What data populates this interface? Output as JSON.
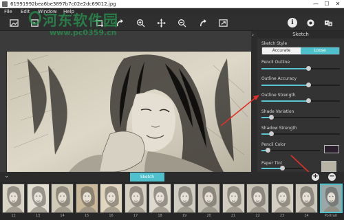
{
  "window": {
    "title": "61991992bea6be3897b7c02e2dc69012.jpg",
    "minimize": "—",
    "maximize": "☐",
    "close": "✕"
  },
  "menu": {
    "items": [
      "File",
      "Edit",
      "Window",
      "Help"
    ]
  },
  "watermark": {
    "text": "河东软件园",
    "url": "www.pc0359.cn"
  },
  "toolbar": {
    "icons": [
      "image-open-icon",
      "image-save-icon",
      "crop-icon",
      "undo-icon",
      "zoom-in-icon",
      "move-icon",
      "zoom-out-icon",
      "redo-icon",
      "fit-icon",
      "info-icon",
      "settings-icon",
      "effects-icon"
    ],
    "info_glyph": "i"
  },
  "panel": {
    "header": "Sketch",
    "sketch_style": {
      "label": "Sketch Style",
      "options": [
        "Accurate",
        "Loose"
      ],
      "selected": "Loose"
    },
    "sliders": [
      {
        "label": "Pencil Outline",
        "value": 0.6
      },
      {
        "label": "Outline Accuracy",
        "value": 0.6
      },
      {
        "label": "Outline Strength",
        "value": 0.6
      },
      {
        "label": "Shade Variation",
        "value": 0.12
      },
      {
        "label": "Shadow Strength",
        "value": 0.12
      }
    ],
    "pencil_color": {
      "label": "Pencil Color",
      "value": 0.1,
      "color": "#2a1f2a"
    },
    "paper_tint": {
      "label": "Paper Tint",
      "value": 0.5,
      "color": "#b8b3a5"
    }
  },
  "bottom": {
    "tab": "Sketch",
    "add": "+",
    "remove": "−"
  },
  "filmstrip": {
    "thumbs": [
      "12",
      "13",
      "14",
      "15",
      "16",
      "17",
      "18",
      "19",
      "20",
      "21",
      "22",
      "23",
      "24",
      "Portrait"
    ],
    "selected_index": 13
  },
  "colors": {
    "accent": "#4ec1cc",
    "arrow": "#e0302a"
  }
}
